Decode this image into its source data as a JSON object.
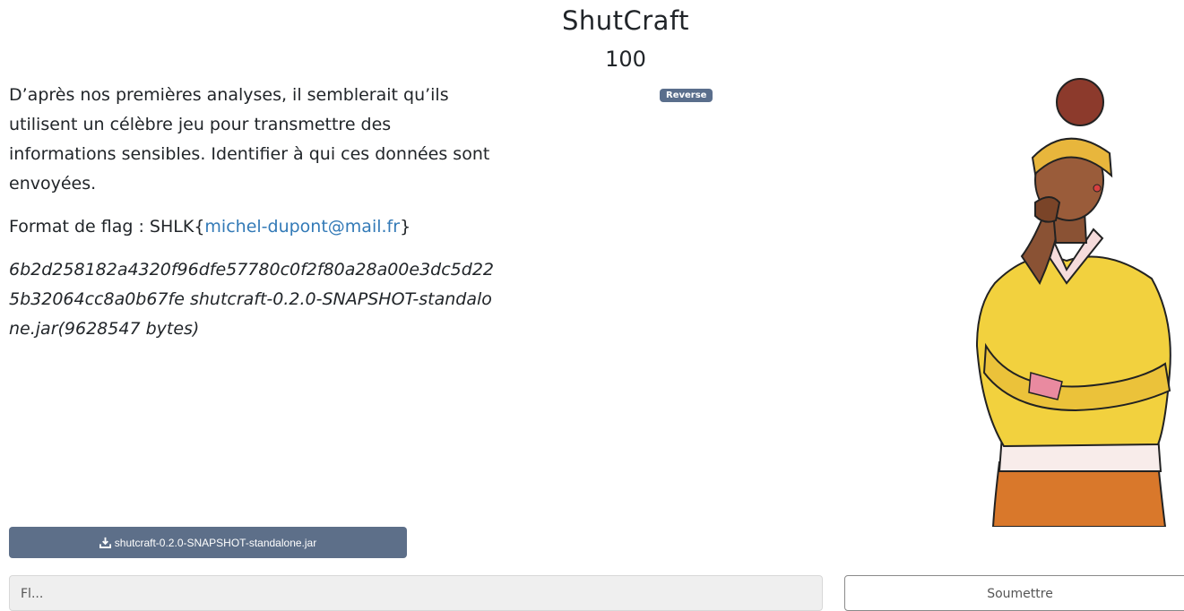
{
  "challenge": {
    "title": "ShutCraft",
    "points": "100",
    "category_badge": "Reverse",
    "description": "D’après nos premières analyses, il semblerait qu’ils utilisent un célèbre jeu pour transmettre des informations sensibles. Identifier à qui ces données sont envoyées.",
    "flag_format_prefix": "Format de flag : SHLK{",
    "flag_format_link": "michel-dupont@mail.fr",
    "flag_format_suffix": "}",
    "file_hash_line": "6b2d258182a4320f96dfe57780c0f2f80a28a00e3dc5d225b32064cc8a0b67fe shutcraft-0.2.0-SNAPSHOT-standalone.jar(9628547 bytes)"
  },
  "download": {
    "label": "shutcraft-0.2.0-SNAPSHOT-standalone.jar",
    "icon": "download-icon"
  },
  "form": {
    "flag_placeholder": "Fl...",
    "submit_label": "Soumettre"
  },
  "colors": {
    "badge": "#5a6e8c",
    "button": "#5d6f89",
    "link": "#337ab7"
  }
}
